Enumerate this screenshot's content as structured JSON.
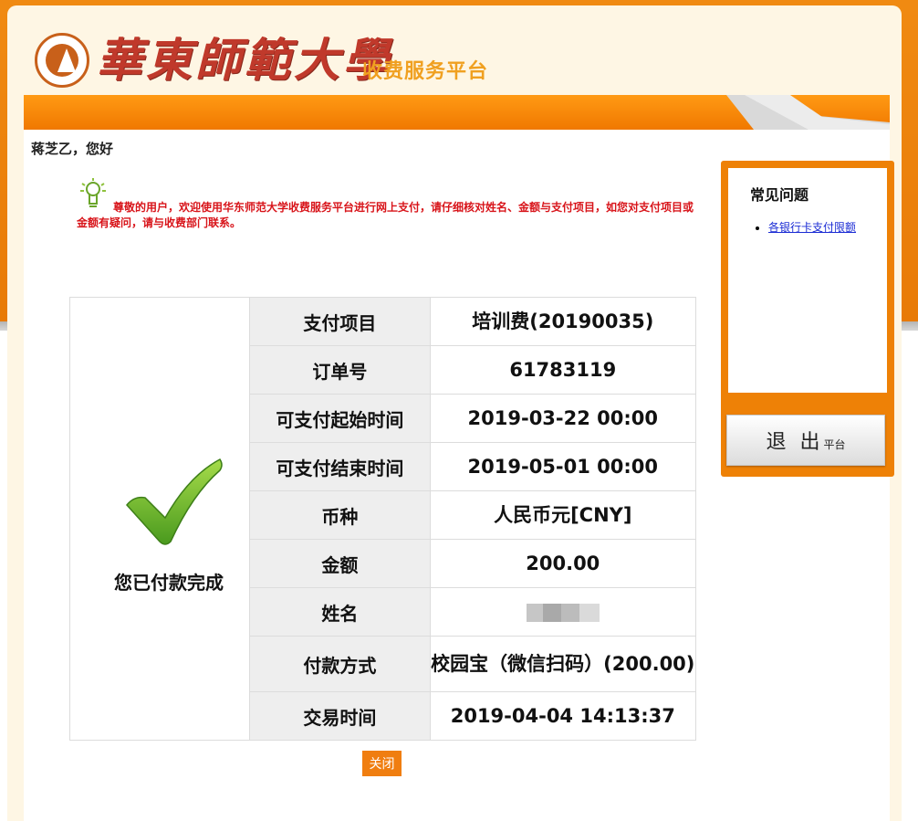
{
  "header": {
    "university_name": "華東師範大學",
    "platform_name": "收费服务平台"
  },
  "greeting": "蒋芝乙，您好",
  "notice": "尊敬的用户，欢迎使用华东师范大学收费服务平台进行网上支付，请仔细核对姓名、金额与支付项目，如您对支付项目或金额有疑问，请与收费部门联系。",
  "payment": {
    "status": "您已付款完成",
    "rows": [
      {
        "label": "支付项目",
        "value": "培训费(20190035)"
      },
      {
        "label": "订单号",
        "value": "61783119"
      },
      {
        "label": "可支付起始时间",
        "value": "2019-03-22 00:00"
      },
      {
        "label": "可支付结束时间",
        "value": "2019-05-01 00:00"
      },
      {
        "label": "币种",
        "value": "人民币元[CNY]"
      },
      {
        "label": "金额",
        "value": "200.00"
      },
      {
        "label": "姓名",
        "value": ""
      },
      {
        "label": "付款方式",
        "value": "校园宝（微信扫码）(200.00)"
      },
      {
        "label": "交易时间",
        "value": "2019-04-04 14:13:37"
      }
    ]
  },
  "close_label": "关闭",
  "faq": {
    "title": "常见问题",
    "items": [
      "各银行卡支付限额"
    ]
  },
  "logout": {
    "main": "退 出",
    "sub": "平台"
  },
  "colors": {
    "brand_orange": "#f07e10",
    "notice_red": "#d8141a",
    "success_green": "#6cb22c"
  }
}
